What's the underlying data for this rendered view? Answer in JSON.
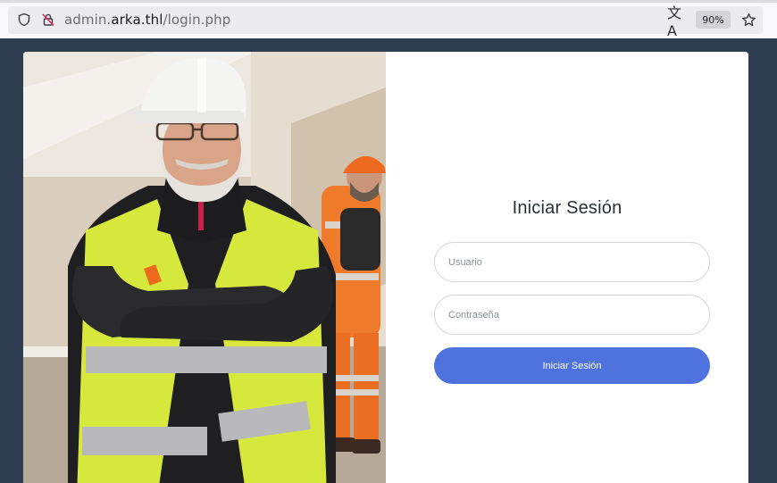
{
  "browser": {
    "url_prefix": "admin.",
    "url_host": "arka.thl",
    "url_path": "/login.php",
    "zoom": "90%",
    "translate_glyph": "文A",
    "icons": [
      "shield-icon",
      "insecure-lock-icon",
      "translate-icon",
      "bookmark-star-icon"
    ]
  },
  "login": {
    "title": "Iniciar Sesión",
    "username_placeholder": "Usuario",
    "password_placeholder": "Contraseña",
    "submit_label": "Iniciar Sesión"
  },
  "colors": {
    "page_background": "#2e3d50",
    "button": "#4e73df",
    "card": "#ffffff"
  }
}
